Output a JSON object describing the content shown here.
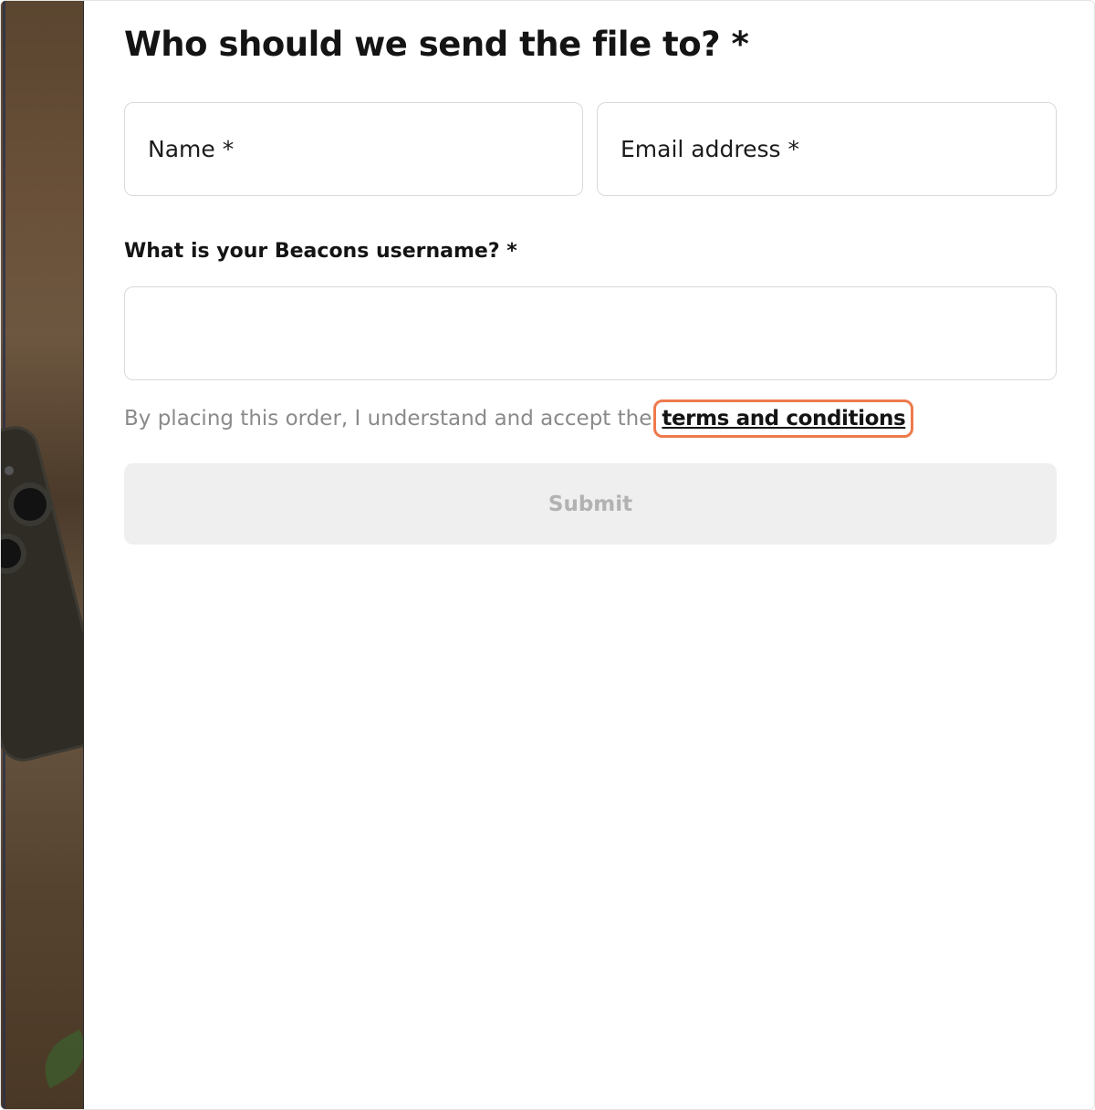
{
  "form": {
    "heading": "Who should we send the file to? *",
    "name_field": {
      "placeholder": "Name *"
    },
    "email_field": {
      "placeholder": "Email address *"
    },
    "username_label": "What is your Beacons username? *",
    "username_field": {
      "value": ""
    },
    "terms_prefix": "By placing this order, I understand and accept the",
    "terms_link": "terms and conditions",
    "submit_label": "Submit"
  },
  "colors": {
    "highlight": "#ee7a4c",
    "submit_bg": "#efefef",
    "submit_text": "#b2b2b2",
    "muted_text": "#8a8a8a"
  }
}
